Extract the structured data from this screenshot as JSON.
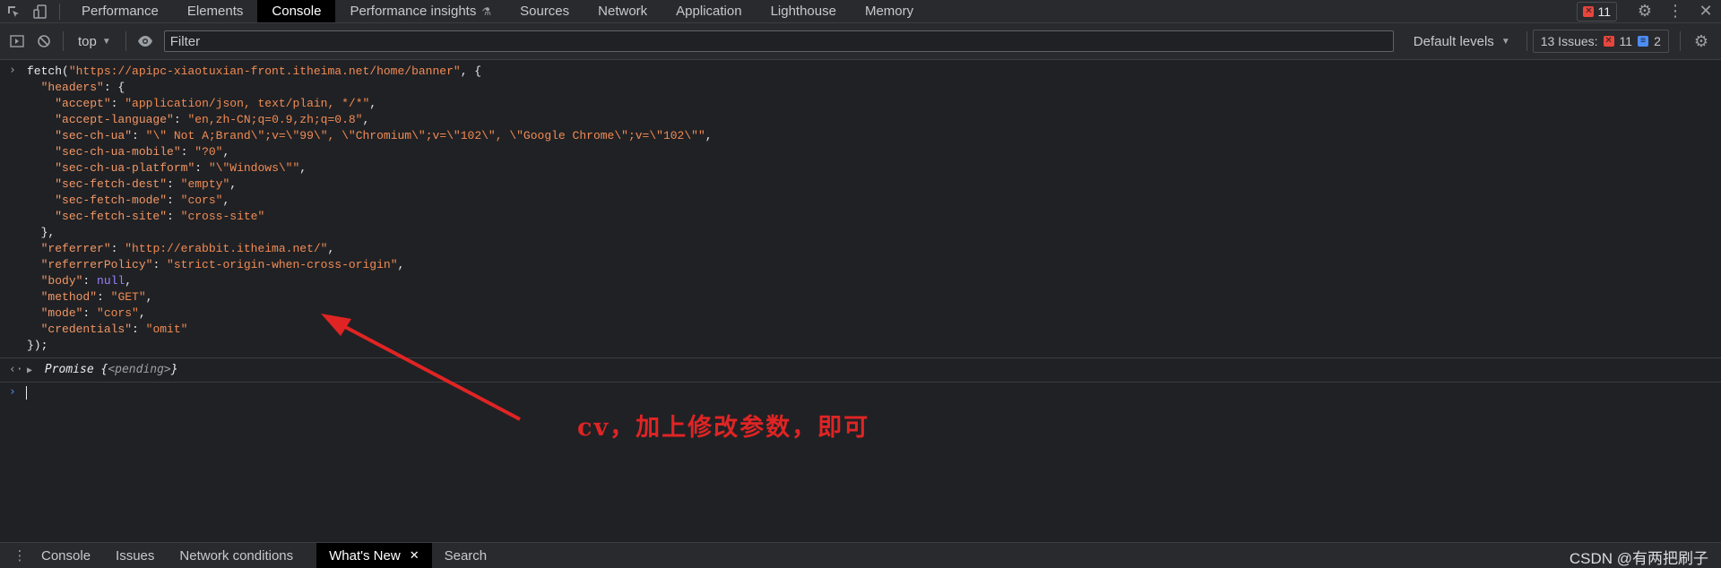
{
  "toolbar_top": {
    "tabs": [
      "Performance",
      "Elements",
      "Console",
      "Performance insights",
      "Sources",
      "Network",
      "Application",
      "Lighthouse",
      "Memory"
    ],
    "active_tab": "Console",
    "error_count": "11"
  },
  "console_toolbar": {
    "context": "top",
    "filter_placeholder": "Filter",
    "levels_label": "Default levels",
    "issues_label": "13 Issues:",
    "issues_errors": "11",
    "issues_messages": "2"
  },
  "console": {
    "lines": [
      "fetch(\"https://apipc-xiaotuxian-front.itheima.net/home/banner\", {",
      "  \"headers\": {",
      "    \"accept\": \"application/json, text/plain, */*\",",
      "    \"accept-language\": \"en,zh-CN;q=0.9,zh;q=0.8\",",
      "    \"sec-ch-ua\": \"\\\" Not A;Brand\\\";v=\\\"99\\\", \\\"Chromium\\\";v=\\\"102\\\", \\\"Google Chrome\\\";v=\\\"102\\\"\",",
      "    \"sec-ch-ua-mobile\": \"?0\",",
      "    \"sec-ch-ua-platform\": \"\\\"Windows\\\"\",",
      "    \"sec-fetch-dest\": \"empty\",",
      "    \"sec-fetch-mode\": \"cors\",",
      "    \"sec-fetch-site\": \"cross-site\"",
      "  },",
      "  \"referrer\": \"http://erabbit.itheima.net/\",",
      "  \"referrerPolicy\": \"strict-origin-when-cross-origin\",",
      "  \"body\": null,",
      "  \"method\": \"GET\",",
      "  \"mode\": \"cors\",",
      "  \"credentials\": \"omit\"",
      "});"
    ],
    "result_type": "Promise",
    "result_state": "<pending>"
  },
  "annotation": {
    "text": "cv，加上修改参数，即可",
    "color": "#e02424"
  },
  "drawer": {
    "tabs": [
      "Console",
      "Issues",
      "Network conditions",
      "What's New",
      "Search"
    ],
    "active_tab": "What's New",
    "watermark": "CSDN @有两把刷子"
  }
}
